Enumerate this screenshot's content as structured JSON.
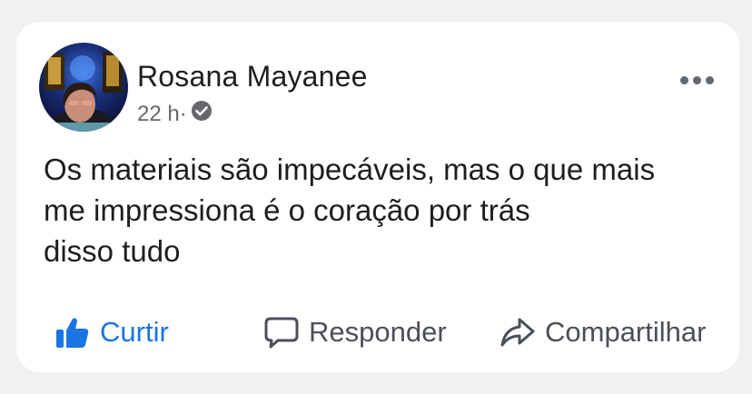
{
  "post": {
    "author": "Rosana Mayanee",
    "time": "22 h·",
    "verified_icon": "verified-badge-icon",
    "text_lines": [
      "Os materiais são impecáveis, mas o que mais",
      "me impressiona é o coração por trás",
      "disso tudo"
    ]
  },
  "actions": {
    "like_label": "Curtir",
    "reply_label": "Responder",
    "share_label": "Compartilhar",
    "like_icon": "thumbs-up-icon",
    "reply_icon": "comment-bubble-icon",
    "share_icon": "share-arrow-icon"
  },
  "colors": {
    "accent": "#1b74e4",
    "text": "#1c1e21",
    "secondary": "#65676b",
    "background": "#f1f1f2",
    "card": "#ffffff"
  }
}
